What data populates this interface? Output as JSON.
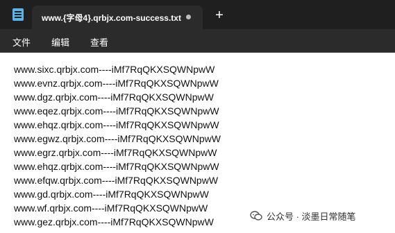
{
  "tab": {
    "title": "www.{字母4}.qrbjx.com-success.txt",
    "new_tab_label": "+"
  },
  "menu": {
    "file": "文件",
    "edit": "编辑",
    "view": "查看"
  },
  "editor": {
    "lines": [
      "www.sixc.qrbjx.com----iMf7RqQKXSQWNpwW",
      "www.evnz.qrbjx.com----iMf7RqQKXSQWNpwW",
      "www.dgz.qrbjx.com----iMf7RqQKXSQWNpwW",
      "www.eqez.qrbjx.com----iMf7RqQKXSQWNpwW",
      "www.ehqz.qrbjx.com----iMf7RqQKXSQWNpwW",
      "www.egwz.qrbjx.com----iMf7RqQKXSQWNpwW",
      "www.egrz.qrbjx.com----iMf7RqQKXSQWNpwW",
      "www.ehqz.qrbjx.com----iMf7RqQKXSQWNpwW",
      "www.efqw.qrbjx.com----iMf7RqQKXSQWNpwW",
      "www.gd.qrbjx.com----iMf7RqQKXSQWNpwW",
      "www.wf.qrbjx.com----iMf7RqQKXSQWNpwW",
      "www.gez.qrbjx.com----iMf7RqQKXSQWNpwW"
    ]
  },
  "watermark": {
    "text": "公众号 · 淡墨日常随笔",
    "icon": "wechat-icon"
  }
}
